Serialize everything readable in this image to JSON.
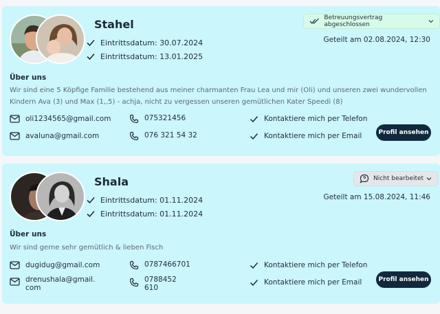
{
  "profiles": [
    {
      "name": "Stahel",
      "entry_dates": [
        "Eintrittsdatum: 30.07.2024",
        "Eintrittsdatum: 13.01.2025"
      ],
      "status": "Betreuungsvertrag abgeschlossen",
      "shared": "Geteilt am 02.08.2024, 12:30",
      "about_title": "Über uns",
      "about_text": "Wir sind eine 5 Köpfige Familie bestehend aus meiner charmanten Frau Lea und mir (Oli) und unseren zwei wundervollen Kindern Ava (3) und Max (1,,5) - achja, nicht zu vergessen unseren gemütlichen Kater Speedi (8)",
      "emails": [
        "oli1234565@gmail.com",
        "avaluna@gmail.com"
      ],
      "phones": [
        "075321456",
        "076 321 54 32"
      ],
      "prefs": [
        "Kontaktiere mich per Telefon",
        "Kontaktiere mich per Email"
      ],
      "button": "Profil ansehen"
    },
    {
      "name": "Shala",
      "entry_dates": [
        "Eintrittsdatum: 01.11.2024",
        "Eintrittsdatum: 01.11.2024"
      ],
      "status": "Nicht bearbeitet",
      "shared": "Geteilt am 15.08.2024, 11:46",
      "about_title": "Über uns",
      "about_text": "Wir sind gerne sehr gemütlich & lieben Fisch",
      "emails": [
        "dugidug@gmail.com",
        "drenushala@gmail. com"
      ],
      "phones": [
        "0787466701",
        "0788452 610"
      ],
      "prefs": [
        "Kontaktiere mich per Telefon",
        "Kontaktiere mich per Email"
      ],
      "button": "Profil ansehen"
    }
  ],
  "colors": {
    "card_bg": "#cbf6fb",
    "button_bg": "#11293d",
    "status_done_bg": "#d6fbe8",
    "status_open_bg": "#e4e7e9"
  }
}
